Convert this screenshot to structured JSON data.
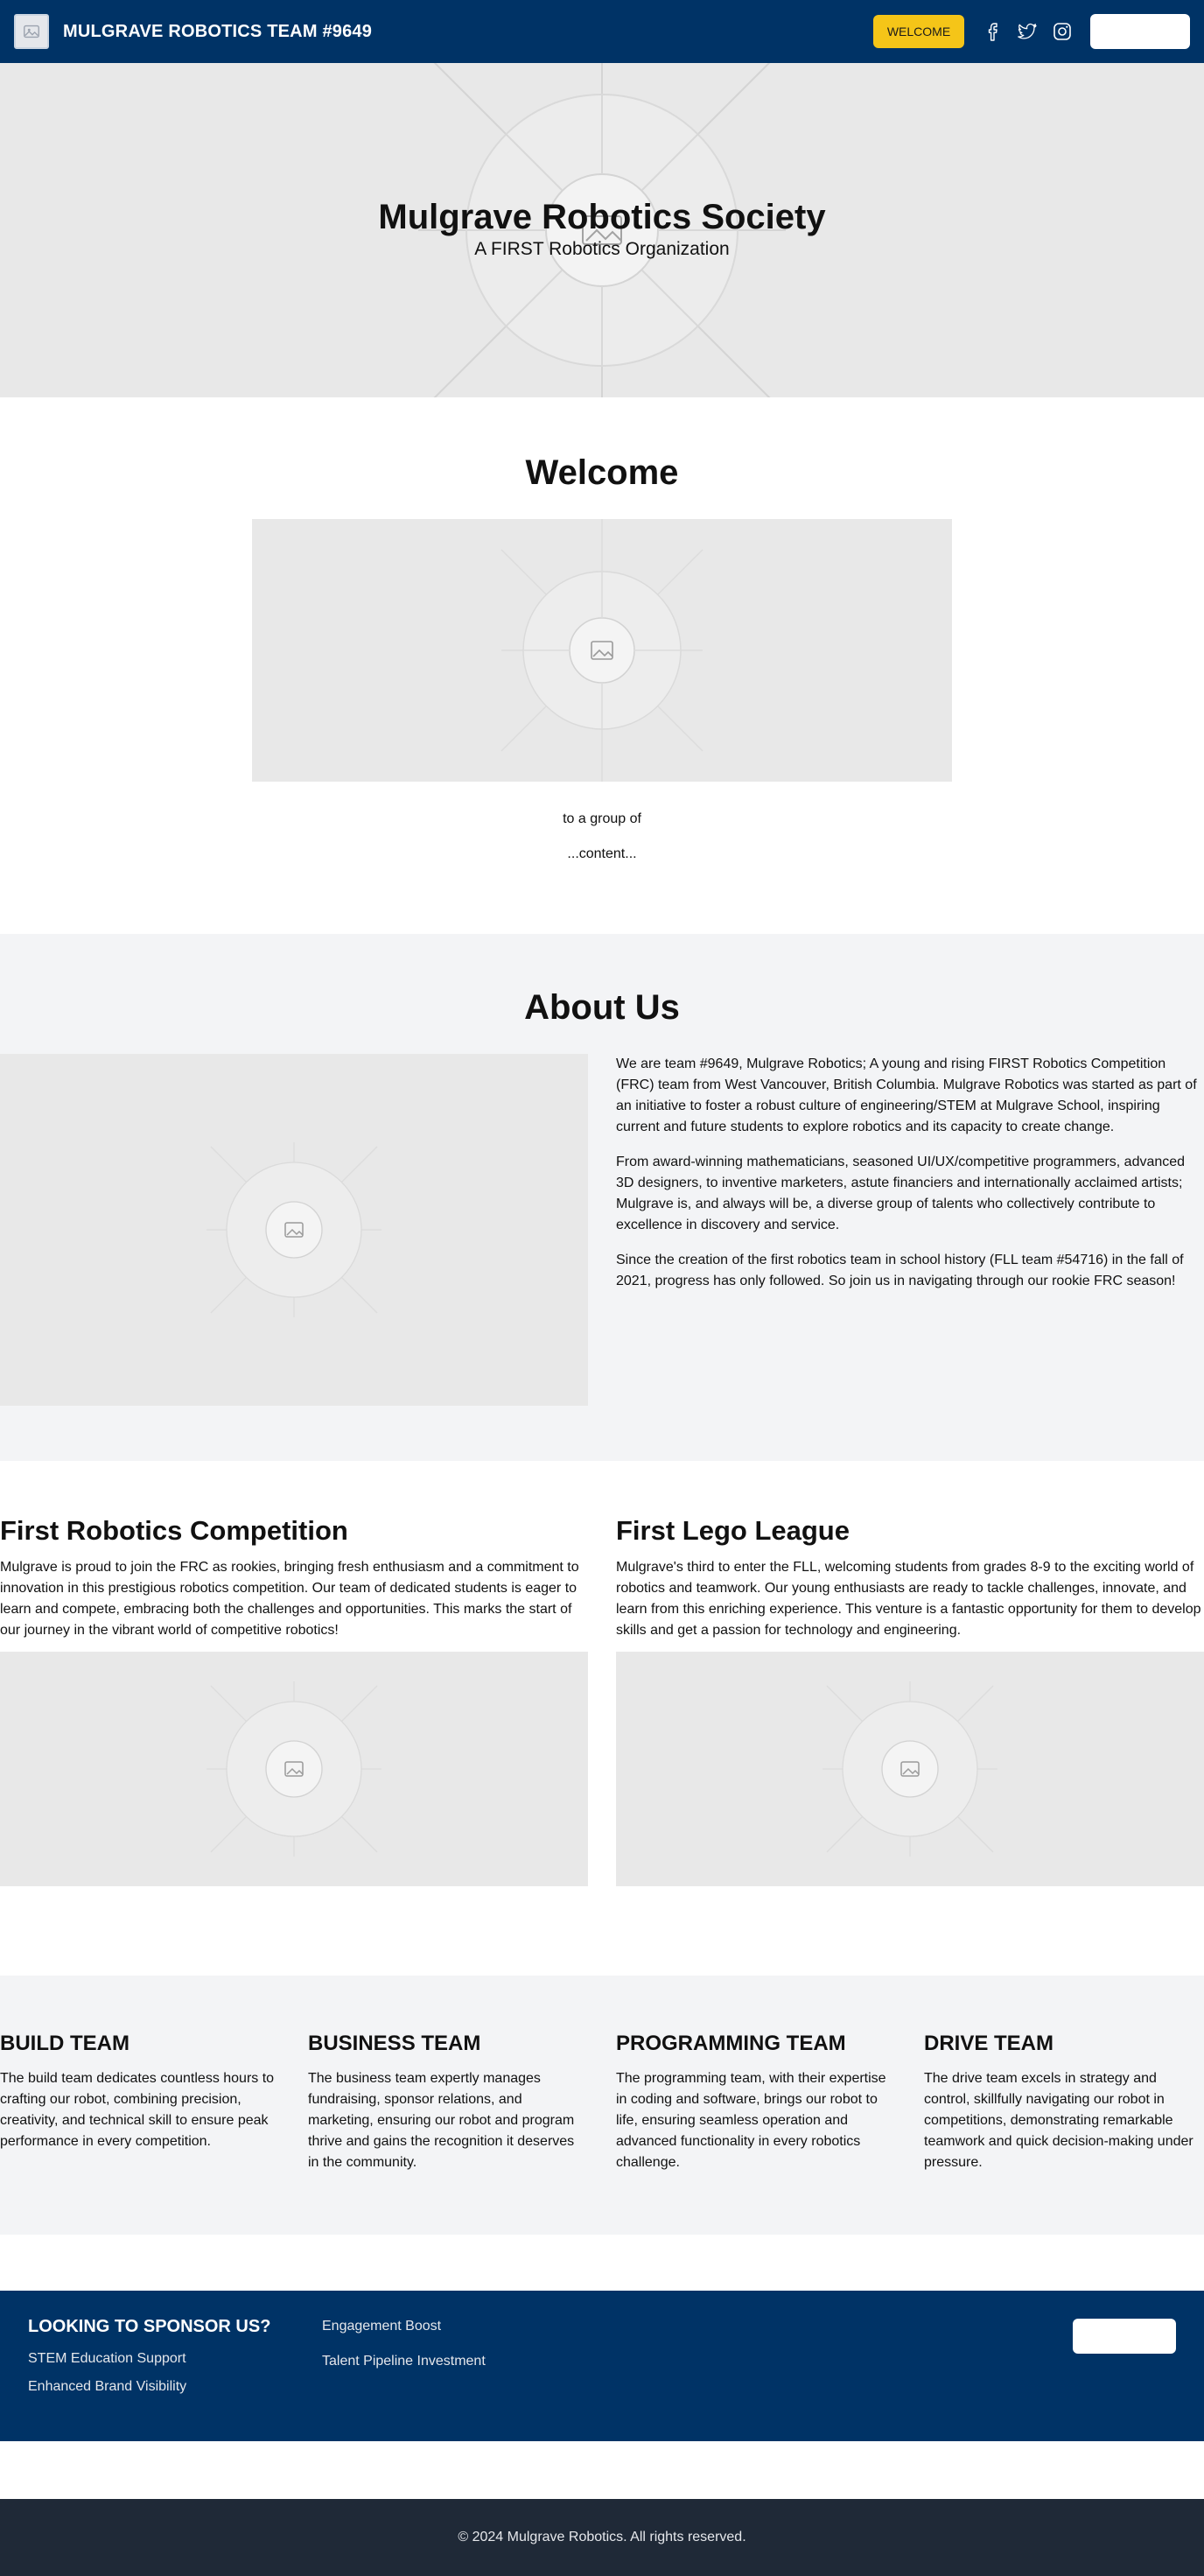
{
  "header": {
    "brand": "MULGRAVE ROBOTICS TEAM #9649",
    "welcome_label": "WELCOME",
    "colors": {
      "primary": "#003366",
      "accent": "#f5c518"
    },
    "social_icons": [
      "facebook-icon",
      "twitter-icon",
      "instagram-icon"
    ]
  },
  "hero": {
    "title": "Mulgrave Robotics Society",
    "subtitle": "A FIRST Robotics Organization"
  },
  "welcome": {
    "title": "Welcome",
    "line1": "to a group of",
    "line2": "...content..."
  },
  "about": {
    "title": "About Us",
    "paragraphs": [
      "We are team #9649, Mulgrave Robotics; A young and rising FIRST Robotics Competition (FRC) team from West Vancouver, British Columbia. Mulgrave Robotics was started as part of an initiative to foster a robust culture of engineering/STEM at Mulgrave School, inspiring current and future students to explore robotics and its capacity to create change.",
      "From award-winning mathematicians, seasoned UI/UX/competitive programmers, advanced 3D designers, to inventive marketers, astute financiers and internationally acclaimed artists; Mulgrave is, and always will be, a diverse group of talents who collectively contribute to excellence in discovery and service.",
      "Since the creation of the first robotics team in school history (FLL team #54716) in the fall of 2021, progress has only followed. So join us in navigating through our rookie FRC season!"
    ]
  },
  "programs": [
    {
      "title": "First Robotics Competition",
      "text": "Mulgrave is proud to join the FRC as rookies, bringing fresh enthusiasm and a commitment to innovation in this prestigious robotics competition. Our team of dedicated students is eager to learn and compete, embracing both the challenges and opportunities. This marks the start of our journey in the vibrant world of competitive robotics!"
    },
    {
      "title": "First Lego League",
      "text": "Mulgrave's third to enter the FLL, welcoming students from grades 8-9 to the exciting world of robotics and teamwork. Our young enthusiasts are ready to tackle challenges, innovate, and learn from this enriching experience. This venture is a fantastic opportunity for them to develop skills and get a passion for technology and engineering."
    }
  ],
  "teams": [
    {
      "title": "BUILD TEAM",
      "text": "The build team dedicates countless hours to crafting our robot, combining precision, creativity, and technical skill to ensure peak performance in every competition."
    },
    {
      "title": "BUSINESS TEAM",
      "text": "The business team expertly manages fundraising, sponsor relations, and marketing, ensuring our robot and program thrive and gains the recognition it deserves in the community."
    },
    {
      "title": "PROGRAMMING TEAM",
      "text": "The programming team, with their expertise in coding and software, brings our robot to life, ensuring seamless operation and advanced functionality in every robotics challenge."
    },
    {
      "title": "DRIVE TEAM",
      "text": "The drive team excels in strategy and control, skillfully navigating our robot in competitions, demonstrating remarkable teamwork and quick decision-making under pressure."
    }
  ],
  "sponsor": {
    "title": "LOOKING TO SPONSOR US?",
    "col1": [
      "STEM Education Support",
      "Enhanced Brand Visibility"
    ],
    "col2": [
      "Engagement Boost",
      "Talent Pipeline Investment"
    ]
  },
  "footer": {
    "copyright": "© 2024 Mulgrave Robotics. All rights reserved."
  }
}
